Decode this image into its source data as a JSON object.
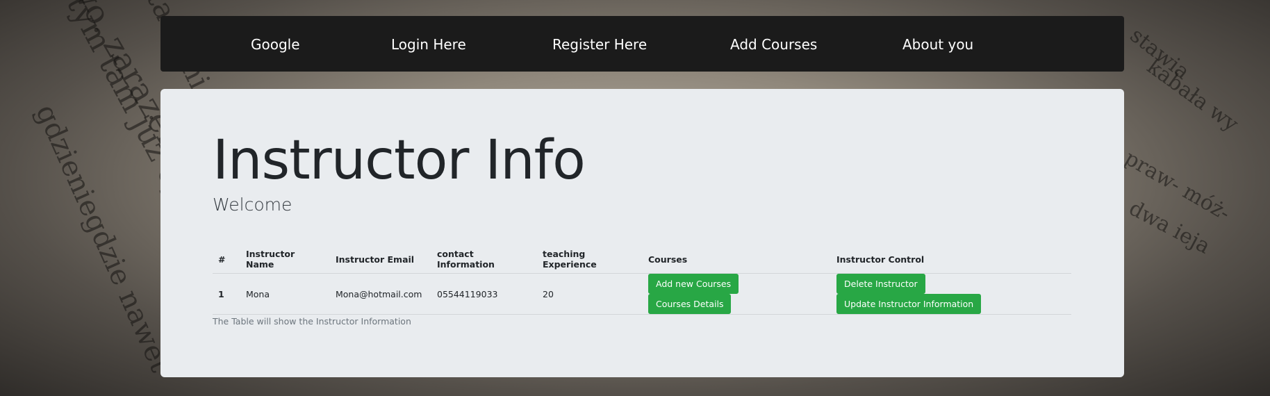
{
  "nav": {
    "items": [
      {
        "label": "Google"
      },
      {
        "label": "Login Here"
      },
      {
        "label": "Register Here"
      },
      {
        "label": "Add Courses"
      },
      {
        "label": "About you"
      }
    ]
  },
  "header": {
    "title": "Instructor Info",
    "subtitle": "Welcome"
  },
  "table": {
    "headers": [
      "#",
      "Instructor Name",
      "Instructor Email",
      "contact Information",
      "teaching Experience",
      "Courses",
      "Instructor Control"
    ],
    "rows": [
      {
        "num": "1",
        "name": "Mona",
        "email": "Mona@hotmail.com",
        "contact": "05544119033",
        "experience": "20",
        "courses_buttons": [
          "Add new Courses",
          "Courses Details"
        ],
        "control_buttons": [
          "Delete Instructor",
          "Update Instructor Information"
        ]
      }
    ],
    "caption": "The Table will show the Instructor Information"
  },
  "colors": {
    "navbar": "#1b1b1b",
    "panel": "#e9ecef",
    "button": "#28a745"
  }
}
